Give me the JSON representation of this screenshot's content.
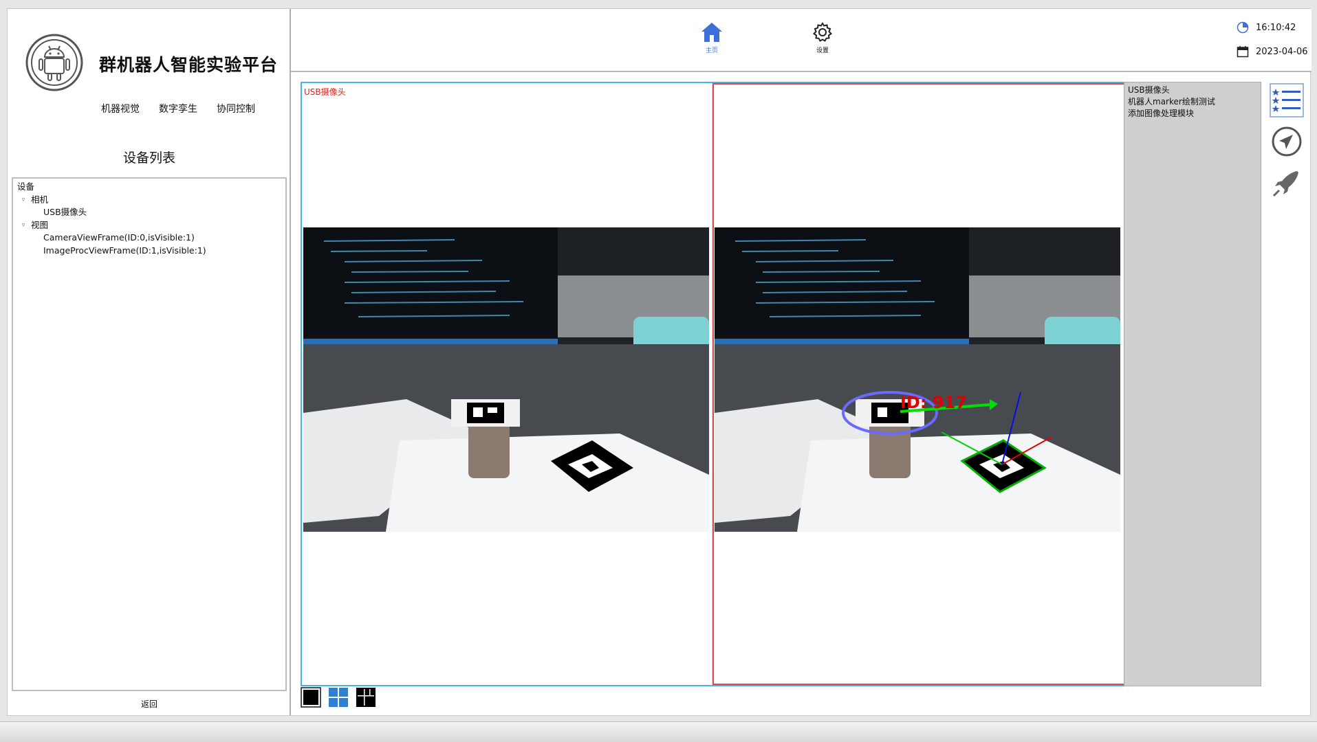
{
  "app": {
    "title": "群机器人智能实验平台",
    "nav": [
      "机器视觉",
      "数字孪生",
      "协同控制"
    ]
  },
  "device_panel": {
    "title": "设备列表",
    "tree": [
      {
        "level": 0,
        "label": "设备",
        "caret": false
      },
      {
        "level": 1,
        "label": "相机",
        "caret": true
      },
      {
        "level": 2,
        "label": "USB摄像头",
        "caret": false
      },
      {
        "level": 1,
        "label": "视图",
        "caret": true
      },
      {
        "level": 2,
        "label": "CameraViewFrame(ID:0,isVisible:1)",
        "caret": false
      },
      {
        "level": 2,
        "label": "ImageProcViewFrame(ID:1,isVisible:1)",
        "caret": false
      }
    ],
    "back_label": "返回"
  },
  "toolbar": {
    "home_label": "主页",
    "settings_label": "设置",
    "time": "16:10:42",
    "date": "2023-04-06"
  },
  "view": {
    "left_caption": "USB摄像头",
    "marker_label": "ID: 917"
  },
  "info_panel": {
    "items": [
      "USB摄像头",
      "机器人marker绘制测试",
      "添加图像处理模块"
    ]
  },
  "colors": {
    "accent_blue": "#3d6fd6",
    "view_border": "#44b6e6",
    "selected_pane": "#e04848",
    "caption_red": "#e02020"
  },
  "icons": [
    "android-logo-icon",
    "home-icon",
    "gear-icon",
    "clock-icon",
    "calendar-icon",
    "list-icon",
    "navigation-icon",
    "rocket-icon"
  ]
}
